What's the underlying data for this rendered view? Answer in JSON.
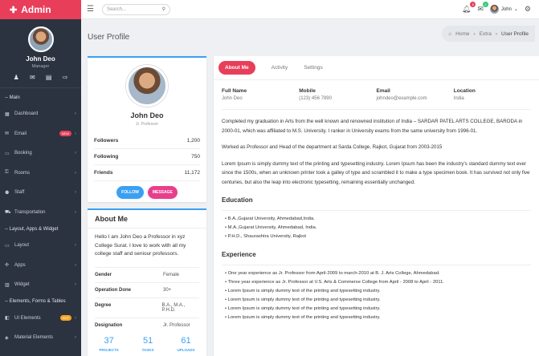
{
  "sidebar": {
    "brand": "Admin",
    "user": {
      "name": "John Deo",
      "role": "Manager"
    },
    "main_label": "-- Main",
    "items": [
      {
        "label": "Dashboard",
        "icon": "dashboard-icon"
      },
      {
        "label": "Email",
        "icon": "email-icon",
        "badge": "NEW"
      },
      {
        "label": "Booking",
        "icon": "booking-icon"
      },
      {
        "label": "Rooms",
        "icon": "key-icon"
      },
      {
        "label": "Staff",
        "icon": "staff-icon"
      },
      {
        "label": "Transportation",
        "icon": "bus-icon"
      }
    ],
    "section2": "-- Layout, Apps & Widget",
    "items2": [
      {
        "label": "Layout",
        "icon": "monitor-icon"
      },
      {
        "label": "Apps",
        "icon": "apps-icon"
      },
      {
        "label": "Widget",
        "icon": "widget-icon"
      }
    ],
    "section3": "-- Elements, Forms & Tables",
    "items3": [
      {
        "label": "UI Elements",
        "icon": "ui-icon",
        "badge": "HOT"
      },
      {
        "label": "Material Elements",
        "icon": "material-icon"
      }
    ]
  },
  "topbar": {
    "search_placeholder": "Search...",
    "notif_count": "6",
    "mail_count": "2",
    "user_name": "John"
  },
  "page": {
    "title": "User Profile",
    "breadcrumb": [
      "Home",
      "Extra",
      "User Profile"
    ]
  },
  "profile_card": {
    "name": "John Deo",
    "role": "Jr. Professor",
    "stats": [
      {
        "k": "Followers",
        "v": "1,200"
      },
      {
        "k": "Following",
        "v": "750"
      },
      {
        "k": "Friends",
        "v": "11,172"
      }
    ],
    "follow_label": "FOLLOW",
    "message_label": "MESSAGE"
  },
  "about": {
    "title": "About Me",
    "text": "Hello I am John Deo a Professor in xyz College Surat. I love to work with all my college staff and seniour professors.",
    "details": [
      {
        "k": "Gender",
        "v": "Female"
      },
      {
        "k": "Operation Done",
        "v": "30+"
      },
      {
        "k": "Degree",
        "v": "B.A., M.A., P.H.D."
      },
      {
        "k": "Designation",
        "v": "Jr. Professor"
      }
    ],
    "counts": [
      {
        "n": "37",
        "l": "PROJECTS"
      },
      {
        "n": "51",
        "l": "TASKS"
      },
      {
        "n": "61",
        "l": "UPLOADS"
      }
    ]
  },
  "main": {
    "tabs": [
      "About Me",
      "Activity",
      "Settings"
    ],
    "info": [
      {
        "k": "Full Name",
        "v": "John Deo"
      },
      {
        "k": "Mobile",
        "v": "(123) 456 7890"
      },
      {
        "k": "Email",
        "v": "johndeo@example.com"
      },
      {
        "k": "Location",
        "v": "India"
      }
    ],
    "para1": "Completed my graduation in Arts from the well known and renowned institution of India – SARDAR PATEL ARTS COLLEGE, BARODA in 2000-01, which was affiliated to M.S. University. I ranker in University exams from the same university from 1996-01.",
    "para2": "Worked as Professor and Head of the department at Sarda College, Rajkot, Gujarat from 2003-2015",
    "para3": "Lorem Ipsum is simply dummy text of the printing and typesetting industry. Lorem Ipsum has been the industry's standard dummy text ever since the 1500s, when an unknown printer took a galley of type and scrambled it to make a type specimen book. It has survived not only five centuries, but also the leap into electronic typesetting, remaining essentially unchanged.",
    "education_title": "Education",
    "education": [
      "B.A.,Gujarat University, Ahmedabad,India.",
      "M.A.,Gujarat University, Ahmedabad, India.",
      "P.H.D., Shaurashtra University, Rajkot"
    ],
    "experience_title": "Experience",
    "experience": [
      "One year experience as Jr. Professor from April-2009 to march-2010 at B. J. Arts College, Ahmedabad.",
      "Three year experience as Jr. Professor at V.S. Arts & Commerse College from April - 2008 to April - 2011.",
      "Lorem Ipsum is simply dummy text of the printing and typesetting industry.",
      "Lorem Ipsum is simply dummy text of the printing and typesetting industry.",
      "Lorem Ipsum is simply dummy text of the printing and typesetting industry.",
      "Lorem Ipsum is simply dummy text of the printing and typesetting industry."
    ]
  }
}
